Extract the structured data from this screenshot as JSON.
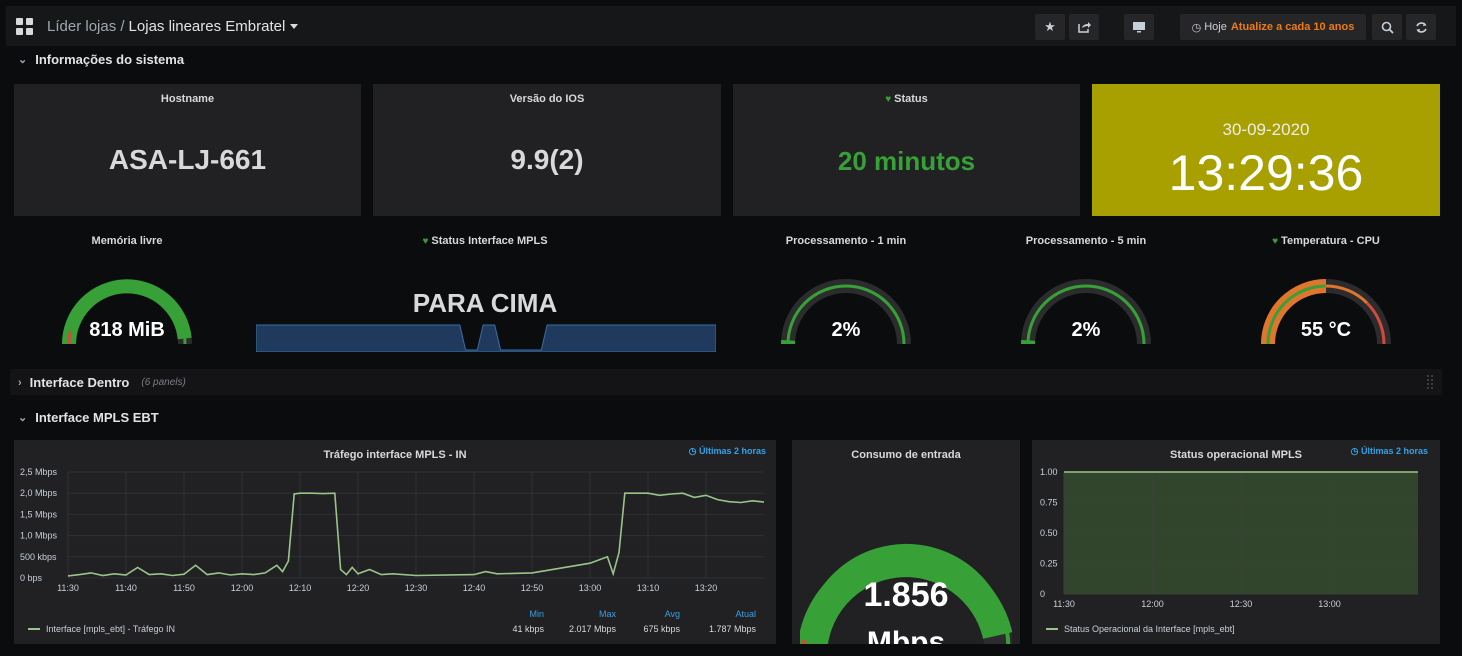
{
  "header": {
    "breadcrumb_parent": "Líder lojas /",
    "breadcrumb_current": "Lojas lineares Embratel",
    "time_label": "Hoje",
    "refresh_label": "Atualize a cada 10 anos"
  },
  "rows": {
    "system": "Informações do sistema",
    "inside": "Interface Dentro",
    "inside_note": "(6 panels)",
    "mpls": "Interface MPLS EBT"
  },
  "panels": {
    "hostname": {
      "title": "Hostname",
      "value": "ASA-LJ-661"
    },
    "ios": {
      "title": "Versão do IOS",
      "value": "9.9(2)"
    },
    "status": {
      "title": "Status",
      "value": "20 minutos"
    },
    "clock": {
      "date": "30-09-2020",
      "time": "13:29:36"
    },
    "memory": {
      "title": "Memória livre",
      "value": "818 MiB",
      "fraction": 0.97
    },
    "mpls_status": {
      "title": "Status Interface MPLS",
      "value": "PARA CIMA"
    },
    "cpu1": {
      "title": "Processamento - 1 min",
      "value": "2%",
      "fraction": 0.02
    },
    "cpu5": {
      "title": "Processamento - 5 min",
      "value": "2%",
      "fraction": 0.02
    },
    "temp": {
      "title": "Temperatura - CPU",
      "value": "55 °C",
      "fraction": 0.5
    },
    "traffic": {
      "title": "Tráfego interface MPLS - IN",
      "time_range": "Últimas 2 horas",
      "legend": "Interface [mpls_ebt] - Tráfego IN",
      "stats_headers": [
        "Min",
        "Max",
        "Avg",
        "Atual"
      ],
      "stats_values": [
        "41 kbps",
        "2.017 Mbps",
        "675 kbps",
        "1.787 Mbps"
      ]
    },
    "consumption": {
      "title": "Consumo de entrada",
      "value": "1.856",
      "unit": "Mbps",
      "fraction": 0.93
    },
    "opstatus": {
      "title": "Status operacional MPLS",
      "time_range": "Últimas 2 horas",
      "legend": "Status Operacional da Interface [mpls_ebt]"
    }
  },
  "colors": {
    "green": "#37a037",
    "orange": "#e0752d",
    "red": "#d44a3a",
    "clock_bg": "#a7a000",
    "series": "#9ac48a",
    "link_blue": "#33a2e5"
  },
  "chart_data": [
    {
      "type": "line",
      "title": "Tráfego interface MPLS - IN",
      "y_ticks": [
        "0 bps",
        "500 kbps",
        "1,0 Mbps",
        "1,5 Mbps",
        "2,0 Mbps",
        "2,5 Mbps"
      ],
      "x_ticks": [
        "11:30",
        "11:40",
        "11:50",
        "12:00",
        "12:10",
        "12:20",
        "12:30",
        "12:40",
        "12:50",
        "13:00",
        "13:10",
        "13:20"
      ],
      "ylim": [
        0,
        2.5
      ],
      "series": [
        {
          "name": "Interface [mpls_ebt] - Tráfego IN",
          "x": [
            "11:30",
            "11:32",
            "11:34",
            "11:36",
            "11:38",
            "11:40",
            "11:42",
            "11:44",
            "11:46",
            "11:48",
            "11:50",
            "11:52",
            "11:54",
            "11:56",
            "11:58",
            "12:00",
            "12:02",
            "12:04",
            "12:06",
            "12:07",
            "12:08",
            "12:09",
            "12:10",
            "12:12",
            "12:14",
            "12:16",
            "12:17",
            "12:18",
            "12:19",
            "12:20",
            "12:22",
            "12:24",
            "12:26",
            "12:30",
            "12:40",
            "12:42",
            "12:44",
            "12:50",
            "13:00",
            "13:03",
            "13:04",
            "13:05",
            "13:06",
            "13:08",
            "13:10",
            "13:12",
            "13:14",
            "13:16",
            "13:18",
            "13:20",
            "13:22",
            "13:24",
            "13:26",
            "13:28",
            "13:30"
          ],
          "values": [
            0.05,
            0.08,
            0.12,
            0.06,
            0.1,
            0.07,
            0.25,
            0.08,
            0.1,
            0.06,
            0.09,
            0.3,
            0.08,
            0.12,
            0.07,
            0.1,
            0.08,
            0.12,
            0.3,
            0.15,
            0.4,
            1.98,
            2.0,
            2.0,
            1.99,
            2.0,
            0.2,
            0.08,
            0.25,
            0.1,
            0.2,
            0.08,
            0.1,
            0.06,
            0.08,
            0.15,
            0.1,
            0.12,
            0.35,
            0.5,
            0.1,
            0.6,
            2.0,
            2.0,
            2.0,
            1.95,
            1.98,
            2.0,
            1.9,
            1.95,
            1.85,
            1.8,
            1.78,
            1.82,
            1.79
          ]
        }
      ]
    },
    {
      "type": "area",
      "title": "Status operacional MPLS",
      "y_ticks": [
        "0",
        "0.25",
        "0.50",
        "0.75",
        "1.00"
      ],
      "x_ticks": [
        "11:30",
        "12:00",
        "12:30",
        "13:00"
      ],
      "ylim": [
        0,
        1
      ],
      "series": [
        {
          "name": "Status Operacional da Interface [mpls_ebt]",
          "x": [
            "11:30",
            "13:30"
          ],
          "values": [
            1,
            1
          ]
        }
      ]
    },
    {
      "type": "area",
      "title": "Status Interface MPLS",
      "series": [
        {
          "values": [
            1,
            1,
            1,
            1,
            1,
            1,
            1,
            1,
            1,
            1,
            1,
            1,
            1,
            1,
            1,
            1,
            1,
            1,
            1,
            1,
            1,
            1,
            1,
            1,
            1,
            1,
            1,
            1,
            1,
            1,
            1,
            1,
            1,
            1,
            1,
            1,
            0,
            0,
            0,
            1,
            1,
            1,
            0,
            0,
            0,
            0,
            0,
            0,
            0,
            0,
            1,
            1,
            1,
            1,
            1,
            1,
            1,
            1,
            1,
            1,
            1,
            1,
            1,
            1,
            1,
            1,
            1,
            1,
            1,
            1,
            1,
            1,
            1,
            1,
            1,
            1,
            1,
            1,
            1,
            1
          ]
        }
      ]
    }
  ]
}
